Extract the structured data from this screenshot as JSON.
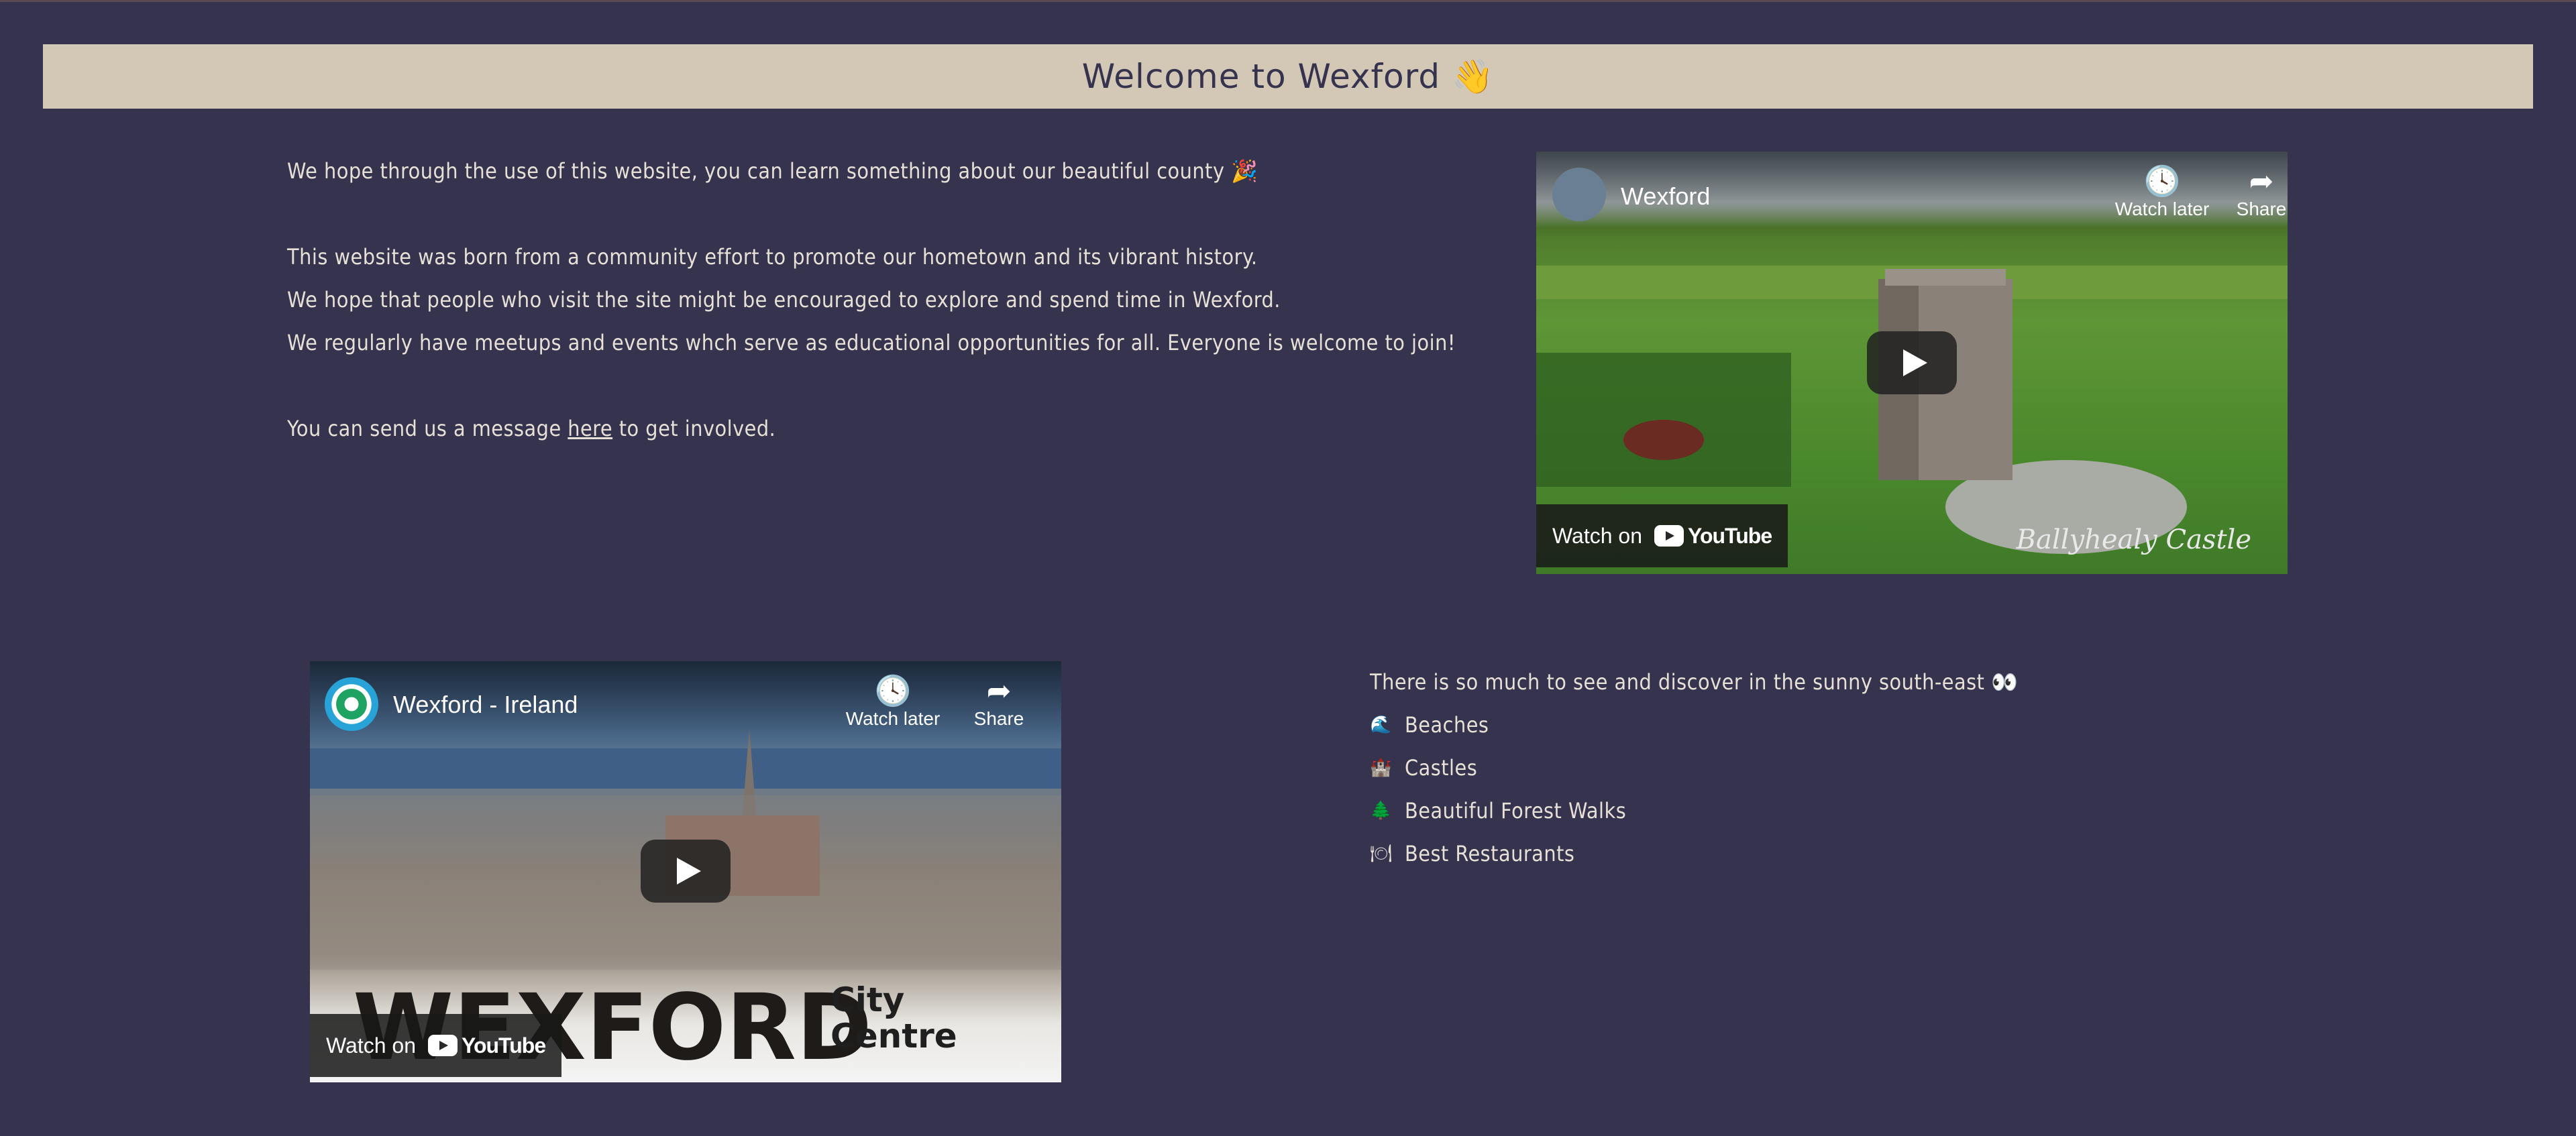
{
  "page": {
    "title": "Welcome to Wexford 👋"
  },
  "intro": {
    "line1": "We hope through the use of this website, you can learn something about our beautiful county 🎉",
    "line2": "This website was born from a community effort to promote our hometown and its vibrant history.",
    "line3": "We hope that people who visit the site might be encouraged to explore and spend time in Wexford.",
    "line4": "We regularly have meetups and events whch serve as educational opportunities for all. Everyone is welcome to join!",
    "contact_prefix": "You can send us a message",
    "contact_link": "here",
    "contact_suffix": "to get involved."
  },
  "video1": {
    "title": "Wexford",
    "watch_later": "Watch later",
    "share": "Share",
    "watch_on": "Watch on",
    "brand": "YouTube",
    "caption": "Ballyhealy Castle"
  },
  "video2": {
    "title": "Wexford - Ireland",
    "watch_later": "Watch later",
    "share": "Share",
    "watch_on": "Watch on",
    "brand": "YouTube",
    "overlay_big": "WEXFORD",
    "overlay_small_1": "City",
    "overlay_small_2": "Centre"
  },
  "discover": {
    "heading": "There is so much to see and discover in the sunny south-east 👀",
    "items": [
      {
        "icon": "🌊",
        "label": "Beaches"
      },
      {
        "icon": "🏰",
        "label": "Castles"
      },
      {
        "icon": "🌲",
        "label": "Beautiful Forest Walks"
      },
      {
        "icon": "🍽",
        "label": "Best Restaurants"
      }
    ]
  },
  "colors": {
    "background": "#35334d",
    "banner": "#d3c7b6",
    "text": "#e6e0d6"
  }
}
